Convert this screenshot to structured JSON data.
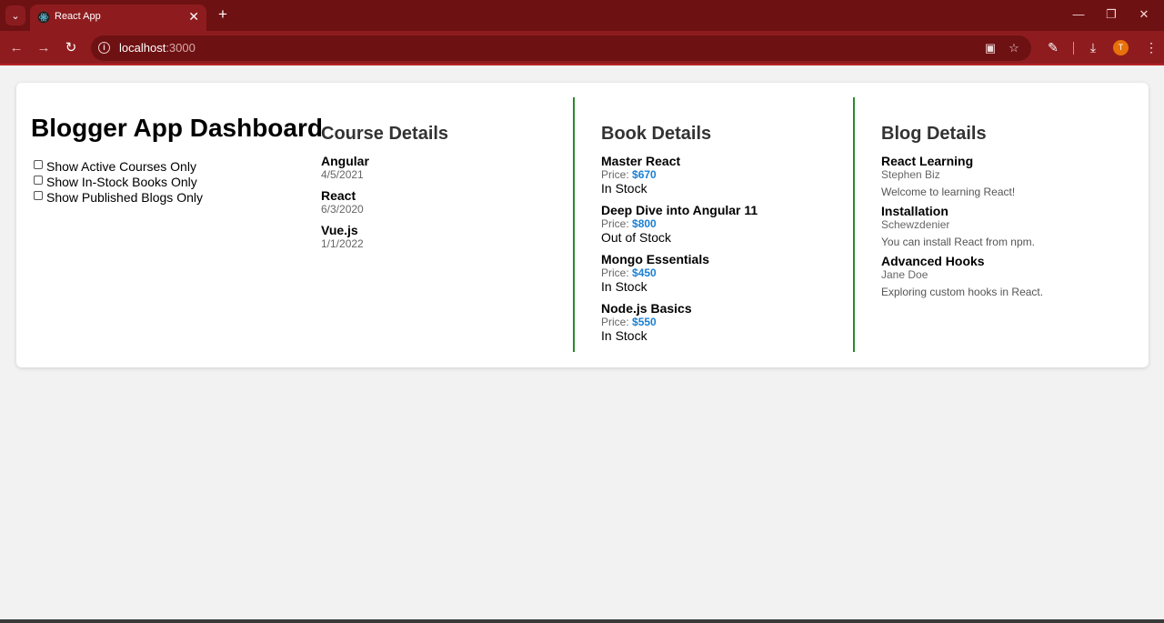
{
  "browser": {
    "tab_title": "React App",
    "url_host": "localhost",
    "url_port": ":3000",
    "profile_initial": "T"
  },
  "app": {
    "title": "Blogger App Dashboard",
    "filters": [
      {
        "label": "Show Active Courses Only",
        "checked": false
      },
      {
        "label": "Show In-Stock Books Only",
        "checked": false
      },
      {
        "label": "Show Published Blogs Only",
        "checked": false
      }
    ]
  },
  "courses": {
    "heading": "Course Details",
    "items": [
      {
        "name": "Angular",
        "date": "4/5/2021"
      },
      {
        "name": "React",
        "date": "6/3/2020"
      },
      {
        "name": "Vue.js",
        "date": "1/1/2022"
      }
    ]
  },
  "books": {
    "heading": "Book Details",
    "price_label": "Price: ",
    "items": [
      {
        "name": "Master React",
        "price": "$670",
        "stock": "In Stock"
      },
      {
        "name": "Deep Dive into Angular 11",
        "price": "$800",
        "stock": "Out of Stock"
      },
      {
        "name": "Mongo Essentials",
        "price": "$450",
        "stock": "In Stock"
      },
      {
        "name": "Node.js Basics",
        "price": "$550",
        "stock": "In Stock"
      }
    ]
  },
  "blogs": {
    "heading": "Blog Details",
    "items": [
      {
        "title": "React Learning",
        "author": "Stephen Biz",
        "content": "Welcome to learning React!"
      },
      {
        "title": "Installation",
        "author": "Schewzdenier",
        "content": "You can install React from npm."
      },
      {
        "title": "Advanced Hooks",
        "author": "Jane Doe",
        "content": "Exploring custom hooks in React."
      }
    ]
  },
  "colors": {
    "tabstrip": "#6e1113",
    "toolbar": "#8e1c1f",
    "divider": "#2a8a2a",
    "price": "#1a7fd4"
  }
}
